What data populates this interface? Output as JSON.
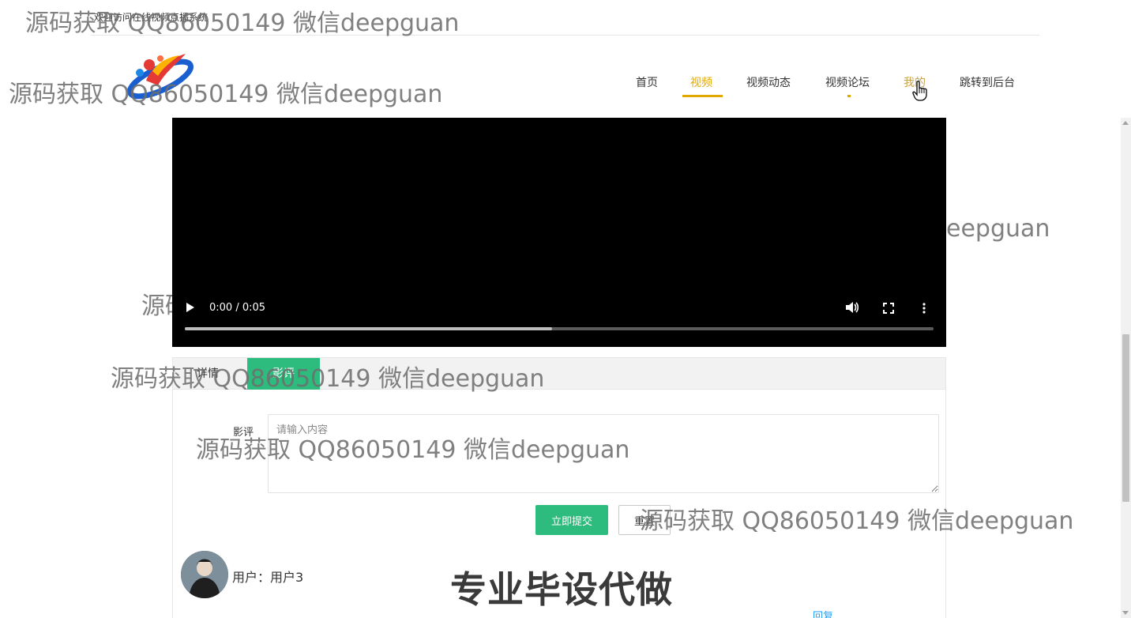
{
  "header": {
    "welcome": "欢迎访问在线视频点播系统"
  },
  "nav": {
    "items": [
      {
        "label": "首页"
      },
      {
        "label": "视频"
      },
      {
        "label": "视频动态"
      },
      {
        "label": "视频论坛"
      },
      {
        "label": "我的"
      },
      {
        "label": "跳转到后台"
      }
    ],
    "active": "视频",
    "hovered": "我的"
  },
  "video": {
    "time": "0:00 / 0:05",
    "buffered": 0.49
  },
  "tabs": {
    "detail": "详情",
    "review": "影评",
    "active": "影评"
  },
  "review_form": {
    "label": "影评",
    "placeholder": "请输入内容",
    "value": "",
    "submit": "立即提交",
    "reset": "重置"
  },
  "comment": {
    "user": "用户：用户3",
    "reply": "回复"
  },
  "watermark": {
    "text": "源码获取 QQ86050149 微信deepguan",
    "right_fragment": "eepguan",
    "left_fragment": "源码",
    "stamp": "专业毕设代做"
  },
  "colors": {
    "accent": "#e0a800",
    "green": "#2dbc7d",
    "link": "#1e9fff"
  },
  "icons": [
    "logo",
    "play-icon",
    "volume-icon",
    "fullscreen-icon",
    "more-vert-icon",
    "hand-cursor-icon"
  ]
}
